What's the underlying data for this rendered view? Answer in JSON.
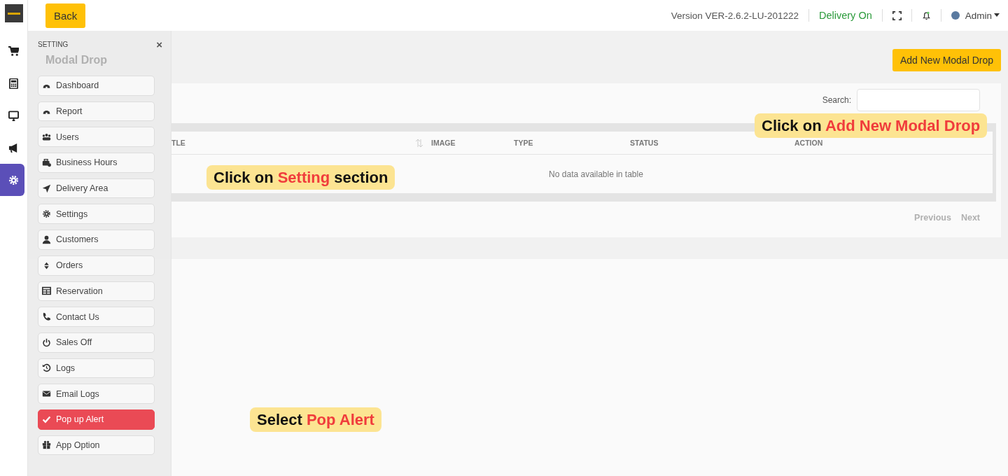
{
  "header": {
    "back_button": "Back",
    "version": "Version VER-2.6.2-LU-201222",
    "delivery_status": "Delivery On",
    "user": "Admin"
  },
  "rail": [
    {
      "selected": false
    },
    {
      "selected": false
    },
    {
      "selected": false
    },
    {
      "selected": false
    },
    {
      "selected": true
    }
  ],
  "sidebar": {
    "title": "SETTING",
    "close": "×",
    "items": [
      {
        "label": "Dashboard",
        "selected": false
      },
      {
        "label": "Report",
        "selected": false
      },
      {
        "label": "Users",
        "selected": false
      },
      {
        "label": "Business Hours",
        "selected": false
      },
      {
        "label": "Delivery Area",
        "selected": false
      },
      {
        "label": "Settings",
        "selected": false
      },
      {
        "label": "Customers",
        "selected": false
      },
      {
        "label": "Orders",
        "selected": false
      },
      {
        "label": "Reservation",
        "selected": false
      },
      {
        "label": "Contact Us",
        "selected": false
      },
      {
        "label": "Sales Off",
        "selected": false
      },
      {
        "label": "Logs",
        "selected": false
      },
      {
        "label": "Email Logs",
        "selected": false
      },
      {
        "label": "Pop up Alert",
        "selected": true
      },
      {
        "label": "App Option",
        "selected": false
      }
    ]
  },
  "page": {
    "title": "Modal Drop",
    "add_button": "Add New Modal Drop",
    "search_label": "Search:",
    "columns": [
      "TLE",
      "IMAGE",
      "TYPE",
      "STATUS",
      "ACTION"
    ],
    "empty_message": "No data available in table",
    "pagination": [
      {
        "label": "Previous",
        "disabled": true
      },
      {
        "label": "Next",
        "disabled": true
      }
    ]
  },
  "callouts": [
    {
      "before": "Click on ",
      "highlight": "Setting",
      "after": " section"
    },
    {
      "before": "Click on ",
      "highlight": "Add New Modal Drop"
    },
    {
      "before": "Select ",
      "highlight": "Pop Alert"
    }
  ]
}
